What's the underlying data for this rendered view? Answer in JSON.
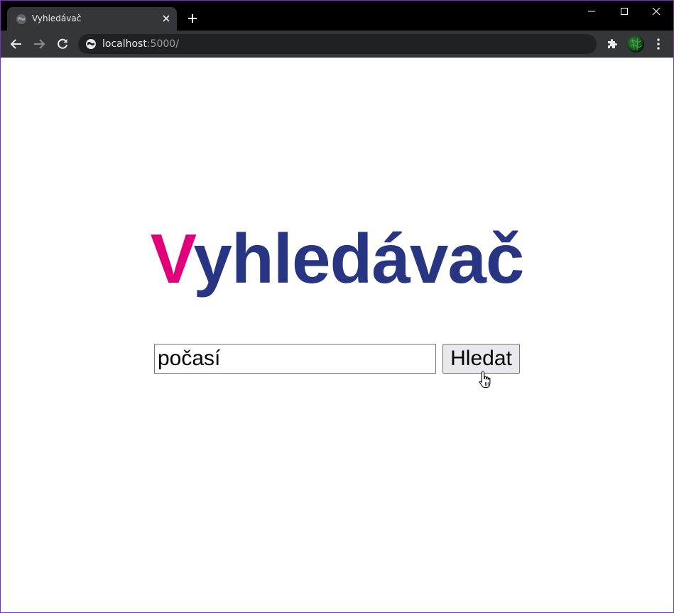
{
  "browser": {
    "tab": {
      "title": "Vyhledávač",
      "favicon": "globe-icon"
    },
    "address": {
      "host": "localhost",
      "path": ":5000/"
    },
    "window_controls": [
      "minimize-icon",
      "maximize-icon",
      "close-icon"
    ],
    "colors": {
      "frame": "#000000",
      "toolbar": "#35363a",
      "omnibox": "#202124"
    }
  },
  "page": {
    "logo": {
      "first_letter": "V",
      "rest": "yhledávač",
      "first_color": "#e0007a",
      "rest_color": "#283583"
    },
    "search": {
      "value": "počasí",
      "button_label": "Hledat"
    }
  }
}
